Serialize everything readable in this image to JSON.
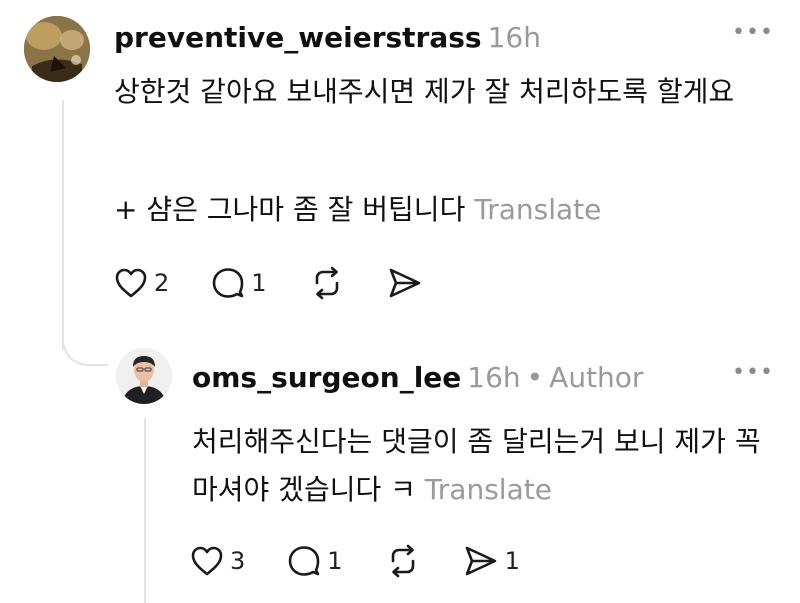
{
  "comment": {
    "username": "preventive_weierstrass",
    "time": "16h",
    "more": "•••",
    "line1": "상한것 같아요 보내주시면 제가 잘 처리하도록 할게요",
    "line2": "+ 샴은 그나마 좀 잘 버팁니다",
    "translate": "Translate",
    "likes": "2",
    "replies": "1",
    "avatar_icon": "user-avatar-icon"
  },
  "reply": {
    "username": "oms_surgeon_lee",
    "time": "16h",
    "separator": "•",
    "role": "Author",
    "more": "•••",
    "text": "처리해주신다는 댓글이 좀 달리는거 보니 제가 꼭 마셔야 겠습니다 ㅋ",
    "translate": "Translate",
    "likes": "3",
    "replies": "1",
    "shares": "1",
    "avatar_icon": "user-avatar-icon"
  },
  "icons": {
    "like": "heart-icon",
    "reply": "comment-bubble-icon",
    "repost": "repost-icon",
    "share": "send-icon"
  },
  "colors": {
    "text": "#111111",
    "muted": "#9a9a9a",
    "thread_line": "#e3e3e3"
  }
}
